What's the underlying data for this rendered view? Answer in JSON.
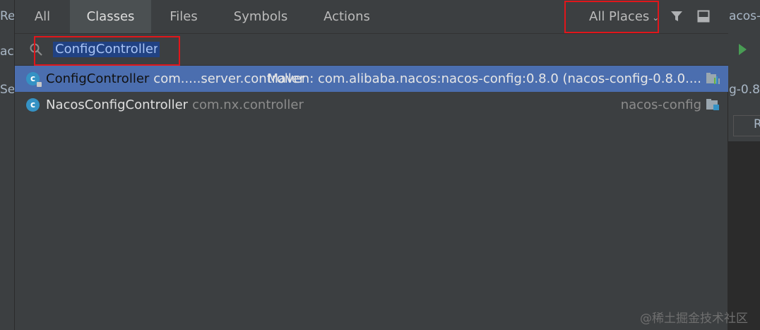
{
  "background": {
    "frag_ref": "Re",
    "frag_naco": "aco",
    "frag_se": "Se",
    "frag_nacos": "acos-",
    "frag_g080": "g-0.8.",
    "frag_r": "R"
  },
  "tabs": [
    {
      "label": "All"
    },
    {
      "label": "Classes"
    },
    {
      "label": "Files"
    },
    {
      "label": "Symbols"
    },
    {
      "label": "Actions"
    }
  ],
  "places": {
    "label": "All Places"
  },
  "search": {
    "value": "ConfigController"
  },
  "results": [
    {
      "name": "ConfigController",
      "package": "com.....server.controller",
      "location": "Maven: com.alibaba.nacos:nacos-config:0.8.0 (nacos-config-0.8.0...."
    },
    {
      "name": "NacosConfigController",
      "package": "com.nx.controller",
      "location": "nacos-config"
    }
  ],
  "watermark": "@稀土掘金技术社区",
  "colors": {
    "accent": "#4b6eaf",
    "highlight_box": "#e0161b",
    "class_icon": "#3592c4"
  }
}
